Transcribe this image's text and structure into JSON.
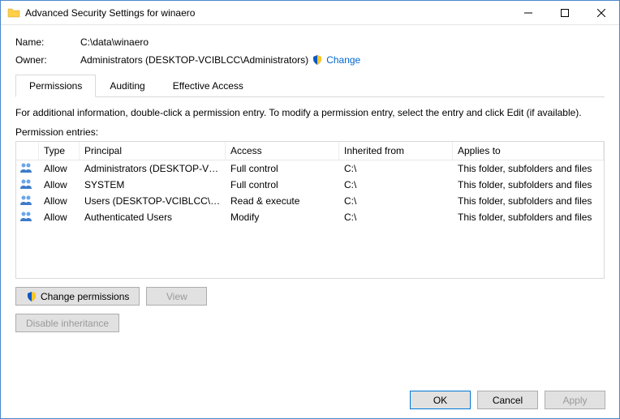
{
  "window": {
    "title": "Advanced Security Settings for winaero"
  },
  "fields": {
    "name_label": "Name:",
    "name_value": "C:\\data\\winaero",
    "owner_label": "Owner:",
    "owner_value": "Administrators (DESKTOP-VCIBLCC\\Administrators)",
    "change_link": "Change"
  },
  "tabs": {
    "permissions": "Permissions",
    "auditing": "Auditing",
    "effective": "Effective Access"
  },
  "info_text": "For additional information, double-click a permission entry. To modify a permission entry, select the entry and click Edit (if available).",
  "entries_label": "Permission entries:",
  "columns": {
    "type": "Type",
    "principal": "Principal",
    "access": "Access",
    "inherited": "Inherited from",
    "applies": "Applies to"
  },
  "rows": [
    {
      "type": "Allow",
      "principal": "Administrators (DESKTOP-VCI...",
      "access": "Full control",
      "inherited": "C:\\",
      "applies": "This folder, subfolders and files"
    },
    {
      "type": "Allow",
      "principal": "SYSTEM",
      "access": "Full control",
      "inherited": "C:\\",
      "applies": "This folder, subfolders and files"
    },
    {
      "type": "Allow",
      "principal": "Users (DESKTOP-VCIBLCC\\Us...",
      "access": "Read & execute",
      "inherited": "C:\\",
      "applies": "This folder, subfolders and files"
    },
    {
      "type": "Allow",
      "principal": "Authenticated Users",
      "access": "Modify",
      "inherited": "C:\\",
      "applies": "This folder, subfolders and files"
    }
  ],
  "buttons": {
    "change_permissions": "Change permissions",
    "view": "View",
    "disable_inheritance": "Disable inheritance",
    "ok": "OK",
    "cancel": "Cancel",
    "apply": "Apply"
  }
}
